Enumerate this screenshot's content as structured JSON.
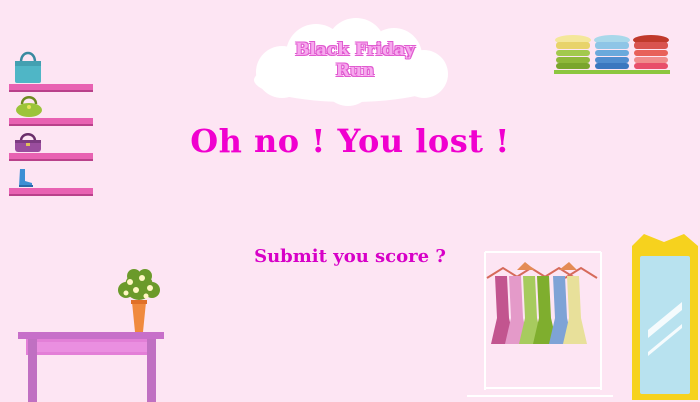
{
  "game": {
    "title_line1": "Black Friday",
    "title_line2": "Run",
    "headline": "Oh no ! You lost !",
    "submit_prompt": "Submit you score ?"
  },
  "colors": {
    "background": "#fde5f3",
    "headline": "#f000cf",
    "submit": "#d700c7",
    "shelf": "#e862b2",
    "table": "#c76fc9",
    "mirror_frame": "#f6d21e"
  },
  "icons": {
    "shelf_items": [
      "handbag-icon",
      "handbag-icon",
      "purse-icon",
      "boot-icon"
    ],
    "decor": [
      "cloud-icon",
      "folded-clothes-icon",
      "flower-pot-icon",
      "clothes-rack-icon",
      "mirror-icon"
    ]
  }
}
